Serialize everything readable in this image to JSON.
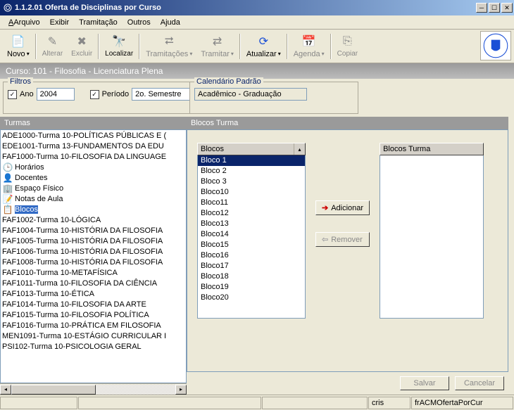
{
  "title": "1.1.2.01 Oferta de Disciplinas por Curso",
  "menu": {
    "arquivo": "Arquivo",
    "exibir": "Exibir",
    "tramitacao": "Tramitação",
    "outros": "Outros",
    "ajuda": "Ajuda"
  },
  "toolbar": {
    "novo": "Novo",
    "alterar": "Alterar",
    "excluir": "Excluir",
    "localizar": "Localizar",
    "tramitacoes": "Tramitações",
    "tramitar": "Tramitar",
    "atualizar": "Atualizar",
    "agenda": "Agenda",
    "copiar": "Copiar"
  },
  "course": "Curso: 101 - Filosofia - Licenciatura Plena",
  "filters": {
    "legend": "Filtros",
    "ano_label": "Ano",
    "ano_value": "2004",
    "periodo_label": "Período",
    "periodo_value": "2o. Semestre"
  },
  "calendar": {
    "legend": "Calendário Padrão",
    "value": "Acadêmico - Graduação"
  },
  "turmas": {
    "header": "Turmas",
    "items": [
      {
        "ico": "",
        "txt": "ADE1000-Turma 10-POLÍTICAS PÚBLICAS E (",
        "sel": false
      },
      {
        "ico": "",
        "txt": "EDE1001-Turma 13-FUNDAMENTOS DA EDU",
        "sel": false
      },
      {
        "ico": "",
        "txt": "FAF1000-Turma 10-FILOSOFIA DA LINGUAGE",
        "sel": false
      },
      {
        "ico": "🕒",
        "txt": "Horários",
        "sel": false
      },
      {
        "ico": "👤",
        "txt": "Docentes",
        "sel": false
      },
      {
        "ico": "🏢",
        "txt": "Espaço Físico",
        "sel": false
      },
      {
        "ico": "📝",
        "txt": "Notas de Aula",
        "sel": false
      },
      {
        "ico": "📋",
        "txt": "Blocos",
        "sel": true
      },
      {
        "ico": "",
        "txt": "FAF1002-Turma 10-LÓGICA",
        "sel": false
      },
      {
        "ico": "",
        "txt": "FAF1004-Turma 10-HISTÓRIA DA FILOSOFIA",
        "sel": false
      },
      {
        "ico": "",
        "txt": "FAF1005-Turma 10-HISTÓRIA DA FILOSOFIA",
        "sel": false
      },
      {
        "ico": "",
        "txt": "FAF1006-Turma 10-HISTÓRIA DA FILOSOFIA",
        "sel": false
      },
      {
        "ico": "",
        "txt": "FAF1008-Turma 10-HISTÓRIA DA FILOSOFIA",
        "sel": false
      },
      {
        "ico": "",
        "txt": "FAF1010-Turma 10-METAFÍSICA",
        "sel": false
      },
      {
        "ico": "",
        "txt": "FAF1011-Turma 10-FILOSOFIA DA CIÊNCIA",
        "sel": false
      },
      {
        "ico": "",
        "txt": "FAF1013-Turma 10-ÉTICA",
        "sel": false
      },
      {
        "ico": "",
        "txt": "FAF1014-Turma 10-FILOSOFIA DA ARTE",
        "sel": false
      },
      {
        "ico": "",
        "txt": "FAF1015-Turma 10-FILOSOFIA POLÍTICA",
        "sel": false
      },
      {
        "ico": "",
        "txt": "FAF1016-Turma 10-PRÁTICA EM FILOSOFIA",
        "sel": false
      },
      {
        "ico": "",
        "txt": "MEN1091-Turma 10-ESTÁGIO CURRICULAR I",
        "sel": false
      },
      {
        "ico": "",
        "txt": "PSI102-Turma 10-PSICOLOGIA GERAL",
        "sel": false
      }
    ]
  },
  "blocos": {
    "header": "Blocos Turma",
    "col_head": "Blocos",
    "right_head": "Blocos Turma",
    "items": [
      "Bloco 1",
      "Bloco 2",
      "Bloco 3",
      "Bloco10",
      "Bloco11",
      "Bloco12",
      "Bloco13",
      "Bloco14",
      "Bloco15",
      "Bloco16",
      "Bloco17",
      "Bloco18",
      "Bloco19",
      "Bloco20"
    ],
    "selected": 0,
    "adicionar": "Adicionar",
    "remover": "Remover",
    "salvar": "Salvar",
    "cancelar": "Cancelar"
  },
  "status": {
    "user": "cris",
    "form": "frACMOfertaPorCur"
  }
}
